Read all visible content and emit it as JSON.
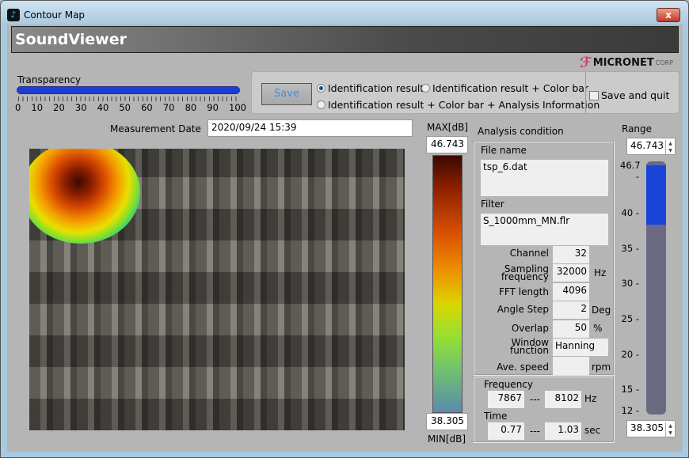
{
  "window": {
    "title": "Contour Map",
    "close_label": "x"
  },
  "header": {
    "title": "SoundViewer"
  },
  "logo": {
    "text": "MICRONET",
    "suffix": "CORP",
    "brand_color": "#e0306b"
  },
  "transparency": {
    "label": "Transparency",
    "value": 100,
    "ticks": [
      "0",
      "10",
      "20",
      "30",
      "40",
      "50",
      "60",
      "70",
      "80",
      "90",
      "100"
    ]
  },
  "options": {
    "save_label": "Save",
    "radios": [
      {
        "label": "Identification result",
        "selected": true
      },
      {
        "label": "Identification result + Color bar",
        "selected": false
      },
      {
        "label": "Identification result + Color bar + Analysis Information",
        "selected": false
      }
    ],
    "save_quit_label": "Save and quit",
    "save_quit_checked": false
  },
  "measurement": {
    "label": "Measurement Date",
    "value": "2020/09/24 15:39"
  },
  "colorbar": {
    "max_label": "MAX[dB]",
    "max": "46.743",
    "min": "38.305",
    "min_label": "MIN[dB]"
  },
  "analysis": {
    "title": "Analysis condition",
    "file_label": "File name",
    "file": "tsp_6.dat",
    "filter_label": "Filter",
    "filter": "S_1000mm_MN.flr",
    "rows": [
      {
        "label": "Channel",
        "value": "32",
        "unit": ""
      },
      {
        "label": "Sampling frequency",
        "value": "32000",
        "unit": "Hz"
      },
      {
        "label": "FFT length",
        "value": "4096",
        "unit": ""
      },
      {
        "label": "Angle Step",
        "value": "2",
        "unit": "Deg"
      },
      {
        "label": "Overlap",
        "value": "50",
        "unit": "%"
      },
      {
        "label": "Window function",
        "value": "Hanning",
        "unit": ""
      },
      {
        "label": "Ave. speed",
        "value": "",
        "unit": "rpm"
      }
    ],
    "frequency": {
      "label": "Frequency",
      "from": "7867",
      "sep": "---",
      "to": "8102",
      "unit": "Hz"
    },
    "time": {
      "label": "Time",
      "from": "0.77",
      "sep": "---",
      "to": "1.03",
      "unit": "sec"
    }
  },
  "range": {
    "label": "Range",
    "upper": "46.743",
    "lower": "38.305",
    "scale": [
      "46.7",
      "40",
      "35",
      "30",
      "25",
      "20",
      "15",
      "12"
    ],
    "scale_min": 12,
    "scale_max": 46.7,
    "fill_color": "#1a44d8"
  }
}
